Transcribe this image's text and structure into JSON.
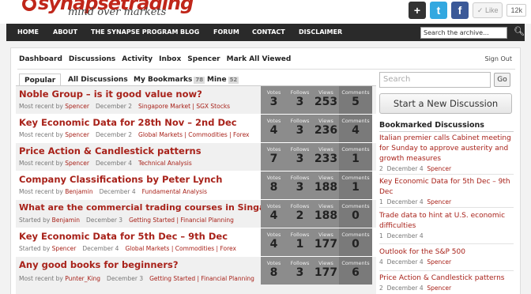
{
  "header": {
    "logo_text": "synapsetrading",
    "tagline": "mind over markets",
    "social": {
      "plus": "+",
      "twitter": "t",
      "facebook": "f",
      "like": "✓ Like",
      "like_count": "12k"
    }
  },
  "nav": {
    "items": [
      "HOME",
      "ABOUT",
      "THE SYNAPSE PROGRAM",
      "BLOG",
      "FORUM",
      "CONTACT",
      "DISCLAIMER"
    ],
    "search_placeholder": "Search the archive..."
  },
  "subnav": {
    "items": [
      "Dashboard",
      "Discussions",
      "Activity",
      "Inbox",
      "Spencer",
      "Mark All Viewed"
    ],
    "sign_out": "Sign Out"
  },
  "tabs": [
    {
      "label": "Popular"
    },
    {
      "label": "All Discussions"
    },
    {
      "label": "My Bookmarks",
      "count": "78"
    },
    {
      "label": "Mine",
      "count": "52"
    }
  ],
  "stat_labels": {
    "votes": "Votes",
    "follows": "Follows",
    "views": "Views",
    "comments": "Comments"
  },
  "discussions": [
    {
      "title": "Noble Group – is it good value now?",
      "prefix": "Most recent by",
      "user": "Spencer",
      "date": "December 2",
      "categories": "Singapore Market | SGX Stocks",
      "votes": "3",
      "follows": "3",
      "views": "253",
      "comments": "5"
    },
    {
      "title": "Key Economic Data for 28th Nov – 2nd Dec",
      "prefix": "Most recent by",
      "user": "Spencer",
      "date": "December 2",
      "categories": "Global Markets | Commodities | Forex",
      "votes": "4",
      "follows": "3",
      "views": "236",
      "comments": "4"
    },
    {
      "title": "Price Action & Candlestick patterns",
      "prefix": "Most recent by",
      "user": "Spencer",
      "date": "December 4",
      "categories": "Technical Analysis",
      "votes": "7",
      "follows": "3",
      "views": "233",
      "comments": "1"
    },
    {
      "title": "Company Classifications by Peter Lynch",
      "prefix": "Most recent by",
      "user": "Benjamin",
      "date": "December 4",
      "categories": "Fundamental Analysis",
      "votes": "8",
      "follows": "3",
      "views": "188",
      "comments": "1"
    },
    {
      "title": "What are the commercial trading courses in Singapore?",
      "prefix": "Started by",
      "user": "Benjamin",
      "date": "December 3",
      "categories": "Getting Started | Financial Planning",
      "votes": "4",
      "follows": "2",
      "views": "188",
      "comments": "0"
    },
    {
      "title": "Key Economic Data for 5th Dec – 9th Dec",
      "prefix": "Started by",
      "user": "Spencer",
      "date": "December 4",
      "categories": "Global Markets | Commodities | Forex",
      "votes": "4",
      "follows": "1",
      "views": "177",
      "comments": "0"
    },
    {
      "title": "Any good books for beginners?",
      "prefix": "Most recent by",
      "user": "Punter_King",
      "date": "December 3",
      "categories": "Getting Started | Financial Planning",
      "votes": "8",
      "follows": "3",
      "views": "177",
      "comments": "6"
    }
  ],
  "sidebar": {
    "search_placeholder": "Search",
    "go_label": "Go",
    "new_discussion": "Start a New Discussion",
    "bookmarked_title": "Bookmarked Discussions",
    "bookmarks": [
      {
        "title": "Italian premier calls Cabinet meeting for Sunday to approve austerity and growth measures",
        "count": "2",
        "date": "December 4",
        "user": "Spencer"
      },
      {
        "title": "Key Economic Data for 5th Dec – 9th Dec",
        "count": "1",
        "date": "December 4",
        "user": "Spencer"
      },
      {
        "title": "Trade data to hint at U.S. economic difficulties",
        "count": "1",
        "date": "December 4",
        "user": ""
      },
      {
        "title": "Outlook for the S&P 500",
        "count": "4",
        "date": "December 4",
        "user": "Spencer"
      },
      {
        "title": "Price Action & Candlestick patterns",
        "count": "2",
        "date": "December 4",
        "user": "Spencer"
      }
    ]
  }
}
